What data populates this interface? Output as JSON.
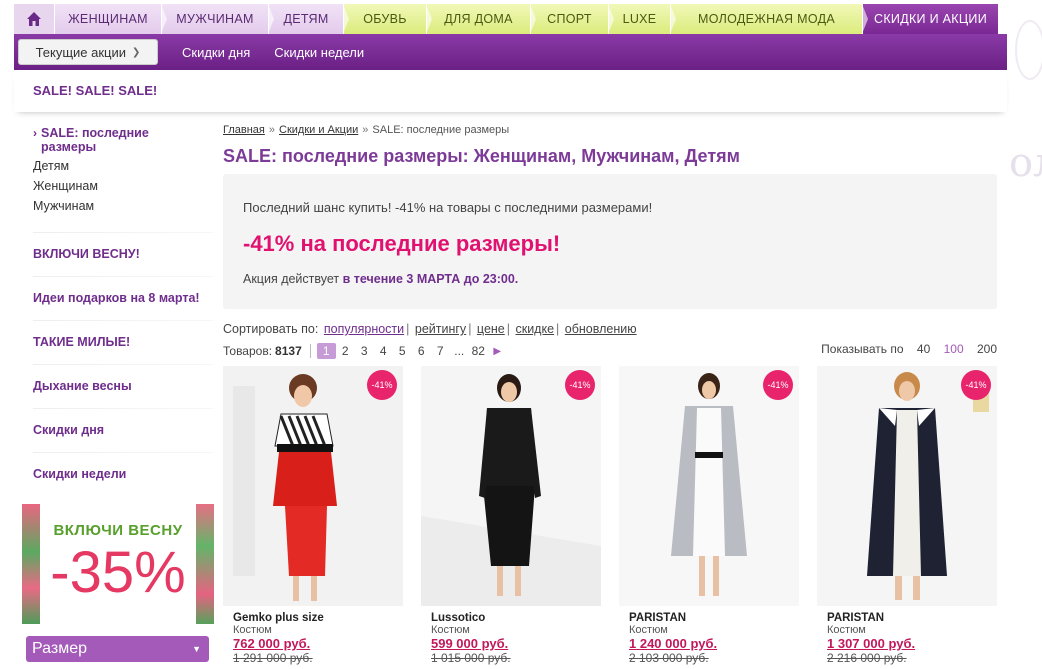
{
  "nav": {
    "home_icon": "home-icon",
    "tabs": [
      {
        "label": "ЖЕНЩИНАМ",
        "style": "pk"
      },
      {
        "label": "МУЖЧИНАМ",
        "style": "pk"
      },
      {
        "label": "ДЕТЯМ",
        "style": "pk"
      },
      {
        "label": "ОБУВЬ",
        "style": "gr"
      },
      {
        "label": "ДЛЯ ДОМА",
        "style": "gr"
      },
      {
        "label": "СПОРТ",
        "style": "gr"
      },
      {
        "label": "LUXE",
        "style": "gr"
      },
      {
        "label": "МОЛОДЕЖНАЯ МОДА",
        "style": "gr"
      },
      {
        "label": "СКИДКИ И АКЦИИ",
        "style": "sale"
      }
    ]
  },
  "subnav": {
    "dropdown_label": "Текущие акции",
    "links": [
      "Скидки дня",
      "Скидки недели"
    ]
  },
  "sale_banner": "SALE! SALE! SALE!",
  "sidebar": {
    "active": "SALE: последние размеры",
    "sub_items": [
      "Детям",
      "Женщинам",
      "Мужчинам"
    ],
    "sections": [
      "ВКЛЮЧИ ВЕСНУ!",
      "Идеи подарков на 8 марта!",
      "ТАКИЕ МИЛЫЕ!",
      "Дыхание весны",
      "Скидки дня",
      "Скидки недели"
    ],
    "promo_text": "ВКЛЮЧИ ВЕСНУ",
    "promo_big": "-35%",
    "size_label": "Размер"
  },
  "breadcrumb": [
    "Главная",
    "Скидки и Акции",
    "SALE: последние размеры"
  ],
  "page_title": "SALE: последние размеры: Женщинам, Мужчинам, Детям",
  "promo_box": {
    "line1": "Последний шанс купить! -41% на товары с последними размерами!",
    "headline": "-41% на последние размеры!",
    "line3_prefix": "Акция действует ",
    "line3_bold": "в течение 3 МАРТА до 23:00."
  },
  "sort": {
    "label": "Сортировать по:",
    "options": [
      "популярности",
      "рейтингу",
      "цене",
      "скидке",
      "обновлению"
    ]
  },
  "pagination": {
    "count_label": "Товаров:",
    "count": "8137",
    "pages": [
      "1",
      "2",
      "3",
      "4",
      "5",
      "6",
      "7",
      "...",
      "82"
    ],
    "current": "1"
  },
  "per_page": {
    "label": "Показывать по",
    "options": [
      "40",
      "100",
      "200"
    ],
    "active": "100"
  },
  "products": [
    {
      "brand": "Gemko plus size",
      "type": "Костюм",
      "price": "762 000 руб.",
      "old_price": "1 291 000 руб.",
      "badge": "-41%"
    },
    {
      "brand": "Lussotico",
      "type": "Костюм",
      "price": "599 000 руб.",
      "old_price": "1 015 000 руб.",
      "badge": "-41%"
    },
    {
      "brand": "PARISTAN",
      "type": "Костюм",
      "price": "1 240 000 руб.",
      "old_price": "2 103 000 руб.",
      "badge": "-41%"
    },
    {
      "brand": "PARISTAN",
      "type": "Костюм",
      "price": "1 307 000 руб.",
      "old_price": "2 216 000 руб.",
      "badge": "-41%"
    }
  ],
  "colors": {
    "accent": "#7a2894",
    "sale_pink": "#e0116f",
    "badge": "#e8256c"
  }
}
